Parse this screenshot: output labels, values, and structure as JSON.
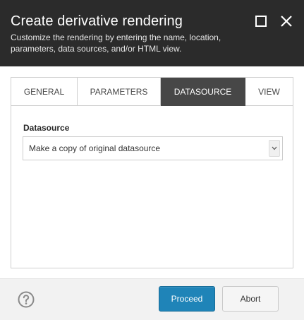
{
  "header": {
    "title": "Create derivative rendering",
    "subtitle": "Customize the rendering by entering the name, location, parameters, data sources, and/or HTML view."
  },
  "tabs": [
    {
      "label": "GENERAL",
      "active": false
    },
    {
      "label": "PARAMETERS",
      "active": false
    },
    {
      "label": "DATASOURCE",
      "active": true
    },
    {
      "label": "VIEW",
      "active": false
    }
  ],
  "datasource": {
    "label": "Datasource",
    "selected": "Make a copy of original datasource"
  },
  "footer": {
    "proceed_label": "Proceed",
    "abort_label": "Abort"
  },
  "colors": {
    "header_bg": "#2b2b2b",
    "active_tab_bg": "#474747",
    "primary_button": "#1f84b8"
  },
  "icons": {
    "maximize": "maximize-icon",
    "close": "close-icon",
    "help": "help-icon",
    "dropdown": "chevron-down-icon"
  }
}
